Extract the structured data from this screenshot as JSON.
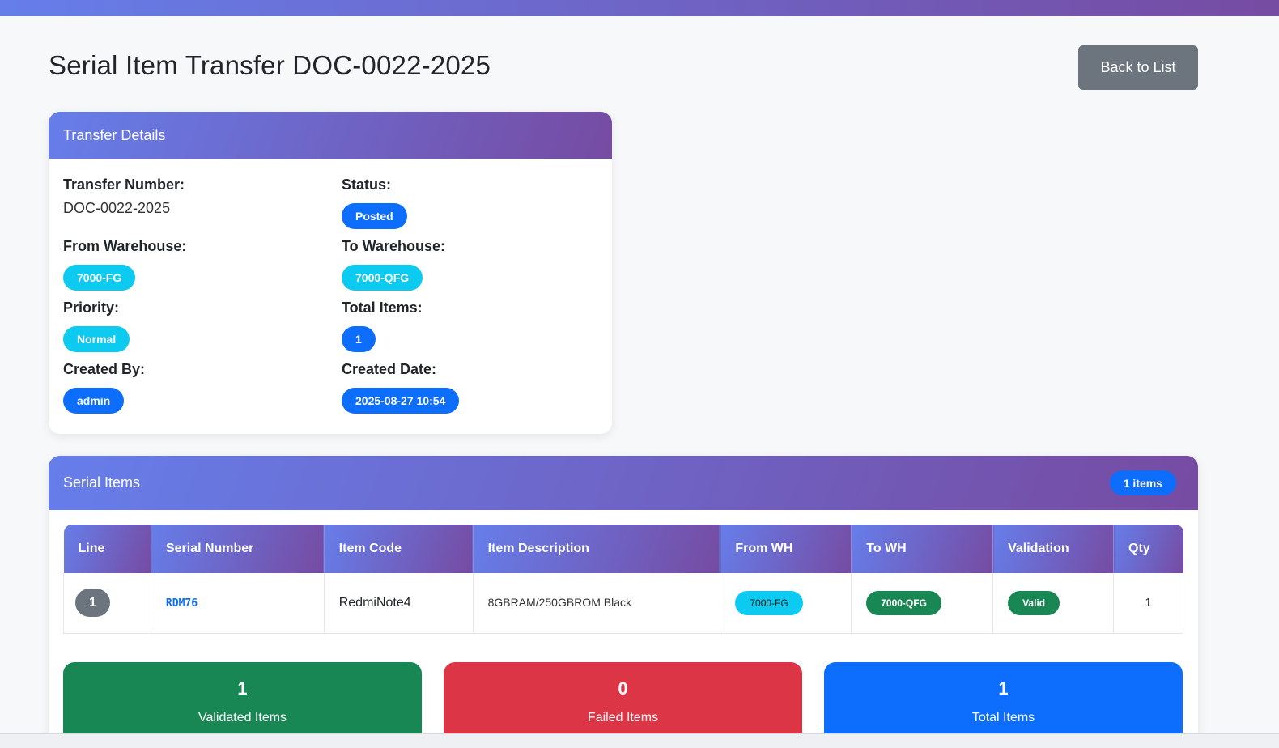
{
  "page": {
    "title": "Serial Item Transfer DOC-0022-2025",
    "back_label": "Back to List"
  },
  "details": {
    "header": "Transfer Details",
    "transfer_number_label": "Transfer Number:",
    "transfer_number_value": "DOC-0022-2025",
    "status_label": "Status:",
    "status_value": "Posted",
    "from_wh_label": "From Warehouse:",
    "from_wh_value": "7000-FG",
    "to_wh_label": "To Warehouse:",
    "to_wh_value": "7000-QFG",
    "priority_label": "Priority:",
    "priority_value": "Normal",
    "total_items_label": "Total Items:",
    "total_items_value": "1",
    "created_by_label": "Created By:",
    "created_by_value": "admin",
    "created_date_label": "Created Date:",
    "created_date_value": "2025-08-27 10:54"
  },
  "items": {
    "header": "Serial Items",
    "count_badge": "1 items",
    "columns": [
      "Line",
      "Serial Number",
      "Item Code",
      "Item Description",
      "From WH",
      "To WH",
      "Validation",
      "Qty"
    ],
    "rows": [
      {
        "line": "1",
        "serial": "RDM76",
        "code": "RedmiNote4",
        "description": "8GBRAM/250GBROM Black",
        "from_wh": "7000-FG",
        "to_wh": "7000-QFG",
        "validation": "Valid",
        "qty": "1"
      }
    ]
  },
  "stats": {
    "validated_value": "1",
    "validated_label": "Validated Items",
    "failed_value": "0",
    "failed_label": "Failed Items",
    "total_value": "1",
    "total_label": "Total Items"
  },
  "colors": {
    "gradient_start": "#667eea",
    "gradient_end": "#764ba2",
    "primary": "#0d6efd",
    "info": "#0dcaf0",
    "success": "#198754",
    "danger": "#dc3545",
    "secondary": "#6c757d"
  }
}
